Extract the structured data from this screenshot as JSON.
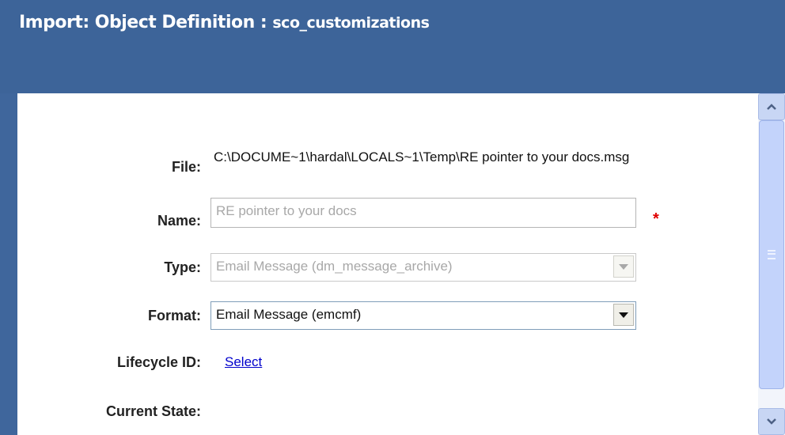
{
  "window": {
    "title_prefix": "Import: Object Definition : ",
    "title_object": "sco_customizations"
  },
  "form": {
    "file": {
      "label": "File:",
      "value": "C:\\DOCUME~1\\hardal\\LOCALS~1\\Temp\\RE pointer to your docs.msg"
    },
    "name": {
      "label": "Name:",
      "value": "RE  pointer to your docs",
      "required_marker": "*"
    },
    "type": {
      "label": "Type:",
      "selected": "Email Message (dm_message_archive)",
      "disabled": true
    },
    "format": {
      "label": "Format:",
      "selected": "Email Message (emcmf)"
    },
    "lifecycle": {
      "label": "Lifecycle ID:",
      "link": "Select"
    },
    "current_state": {
      "label": "Current State:"
    }
  },
  "colors": {
    "header": "#3d6499",
    "required": "#e00000",
    "link": "#0000cc"
  },
  "icons": {
    "scroll_up": "chevron-up-icon",
    "scroll_down": "chevron-down-icon",
    "dropdown": "dropdown-arrow-icon"
  }
}
